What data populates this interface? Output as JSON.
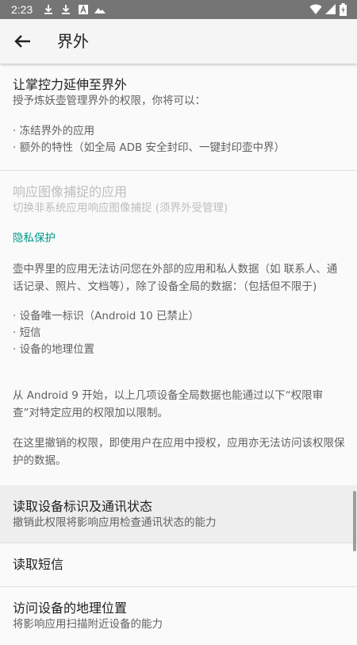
{
  "status_bar": {
    "time": "2:23",
    "notification_icons": [
      "download-icon",
      "download-icon",
      "app-icon",
      "photo-icon"
    ],
    "right_icons": [
      "wifi-icon",
      "signal-icon",
      "battery-icon"
    ]
  },
  "app_bar": {
    "title": "界外"
  },
  "extend": {
    "title": "让掌控力延伸至界外",
    "summary": "授予炼妖壶管理界外的权限，你将可以：",
    "bullets": [
      "· 冻结界外的应用",
      "· 额外的特性（如全局 ADB 安全封印、一键封印壶中界）"
    ]
  },
  "capture": {
    "title": "响应图像捕捉的应用",
    "summary": "切换非系统应用响应图像捕捉 (须界外受管理)"
  },
  "privacy": {
    "category": "隐私保护",
    "intro": "壶中界里的应用无法访问您在外部的应用和私人数据（如 联系人、通话记录、照片、文档等），除了设备全局的数据：（包括但不限于)",
    "bullets": [
      "· 设备唯一标识（Android 10 已禁止）",
      "· 短信",
      "· 设备的地理位置"
    ],
    "para2": "从 Android 9 开始，以上几项设备全局数据也能通过以下“权限审查”对特定应用的权限加以限制。",
    "para3": "在这里撤销的权限，即使用户在应用中授权，应用亦无法访问该权限保护的数据。"
  },
  "permissions": [
    {
      "title": "读取设备标识及通讯状态",
      "summary": "撤销此权限将影响应用检查通讯状态的能力"
    },
    {
      "title": "读取短信",
      "summary": ""
    },
    {
      "title": "访问设备的地理位置",
      "summary": "将影响应用扫描附近设备的能力"
    }
  ],
  "colors": {
    "accent": "#009688",
    "status_bar": "#757575",
    "app_bar": "#f5f5f5",
    "background": "#fafafa"
  }
}
